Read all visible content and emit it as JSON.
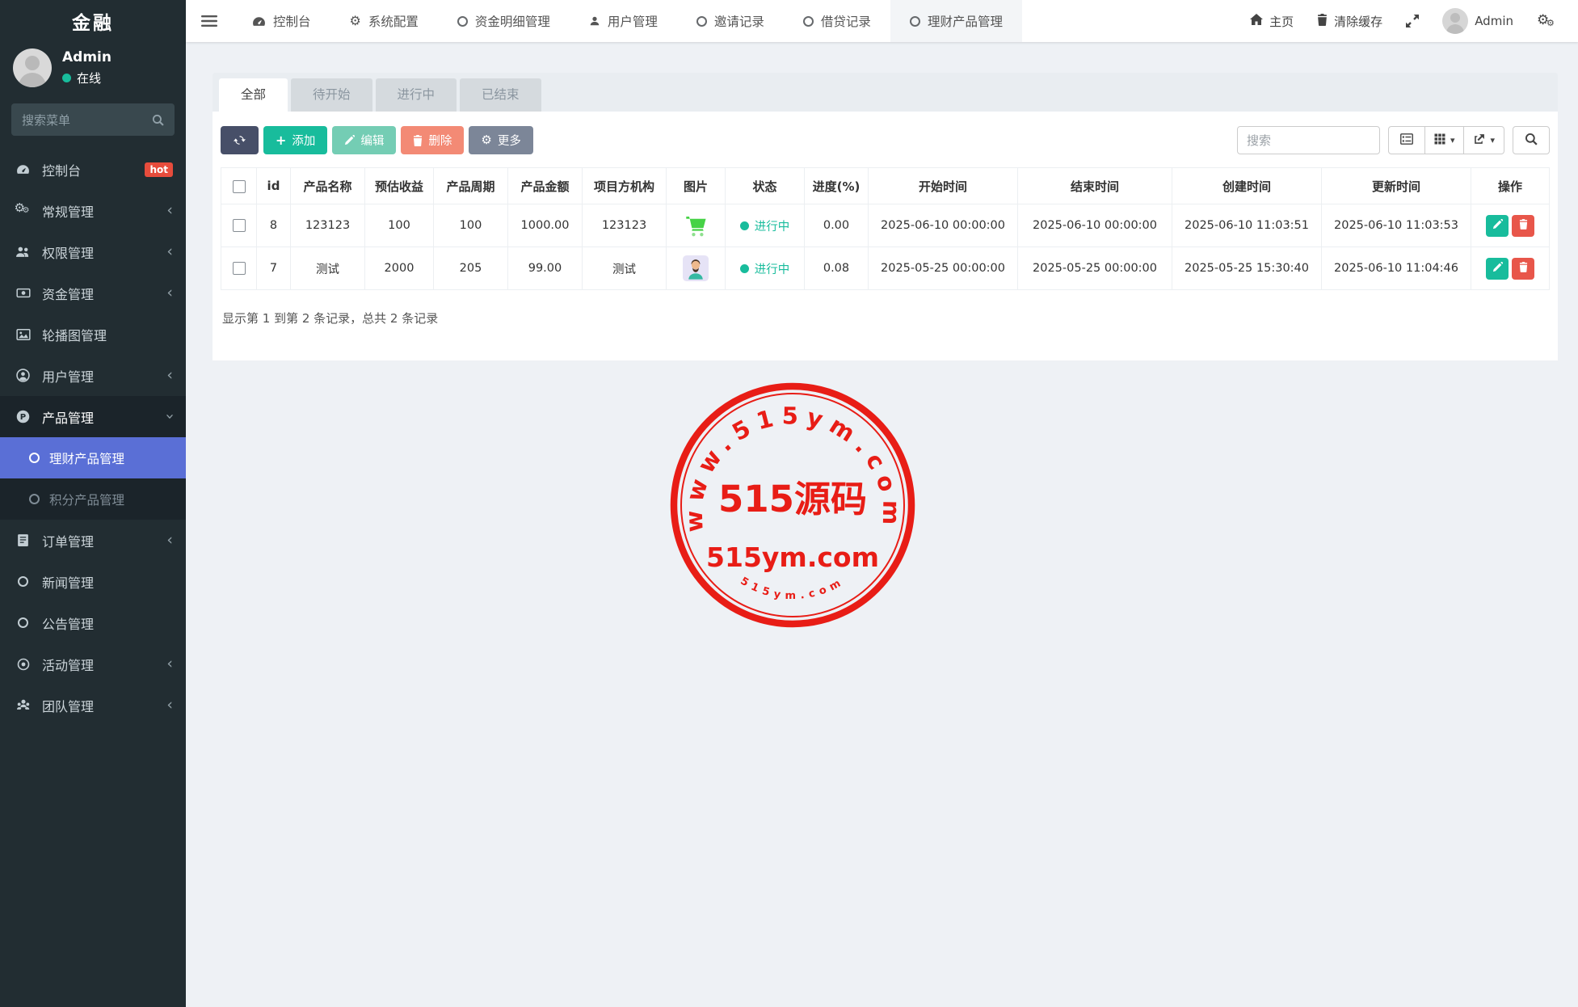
{
  "app": {
    "brand": "金融"
  },
  "sidebar": {
    "user": {
      "name": "Admin",
      "status_label": "在线"
    },
    "search_placeholder": "搜索菜单",
    "items": [
      {
        "key": "console",
        "label": "控制台",
        "icon": "dashboard-icon",
        "badge": "hot"
      },
      {
        "key": "general",
        "label": "常规管理",
        "icon": "gears-icon",
        "chevron": true
      },
      {
        "key": "permission",
        "label": "权限管理",
        "icon": "users-icon",
        "chevron": true
      },
      {
        "key": "funds",
        "label": "资金管理",
        "icon": "money-icon",
        "chevron": true
      },
      {
        "key": "banner",
        "label": "轮播图管理",
        "icon": "image-icon"
      },
      {
        "key": "users",
        "label": "用户管理",
        "icon": "user-circle-icon",
        "chevron": true
      },
      {
        "key": "products",
        "label": "产品管理",
        "icon": "p-circle-icon",
        "expanded": true,
        "children": [
          {
            "key": "wealth-products",
            "label": "理财产品管理",
            "active": true
          },
          {
            "key": "points-products",
            "label": "积分产品管理"
          }
        ]
      },
      {
        "key": "orders",
        "label": "订单管理",
        "icon": "orders-icon",
        "chevron": true
      },
      {
        "key": "news",
        "label": "新闻管理",
        "icon": "circle-icon"
      },
      {
        "key": "notice",
        "label": "公告管理",
        "icon": "circle-icon"
      },
      {
        "key": "activity",
        "label": "活动管理",
        "icon": "dot-circle-icon",
        "chevron": true
      },
      {
        "key": "team",
        "label": "团队管理",
        "icon": "team-icon",
        "chevron": true
      }
    ]
  },
  "topnav": {
    "tabs": [
      {
        "key": "console",
        "label": "控制台",
        "icon": "dashboard-icon"
      },
      {
        "key": "system-config",
        "label": "系统配置",
        "icon": "gear-icon"
      },
      {
        "key": "fund-details",
        "label": "资金明细管理",
        "icon": "circle-icon"
      },
      {
        "key": "user-mgmt",
        "label": "用户管理",
        "icon": "user-icon"
      },
      {
        "key": "invite-records",
        "label": "邀请记录",
        "icon": "circle-icon"
      },
      {
        "key": "loan-records",
        "label": "借贷记录",
        "icon": "circle-icon"
      },
      {
        "key": "wealth-products",
        "label": "理财产品管理",
        "icon": "circle-icon",
        "active": true
      }
    ],
    "home_label": "主页",
    "clear_cache_label": "清除缓存",
    "admin_label": "Admin"
  },
  "filter_tabs": [
    {
      "key": "all",
      "label": "全部",
      "active": true
    },
    {
      "key": "not-started",
      "label": "待开始"
    },
    {
      "key": "in-progress",
      "label": "进行中"
    },
    {
      "key": "finished",
      "label": "已结束"
    }
  ],
  "toolbar": {
    "add_label": "添加",
    "edit_label": "编辑",
    "delete_label": "删除",
    "more_label": "更多",
    "search_placeholder": "搜索"
  },
  "table": {
    "columns": [
      "id",
      "产品名称",
      "预估收益",
      "产品周期",
      "产品金额",
      "项目方机构",
      "图片",
      "状态",
      "进度(%)",
      "开始时间",
      "结束时间",
      "创建时间",
      "更新时间",
      "操作"
    ],
    "rows": [
      {
        "id": "8",
        "product_name": "123123",
        "expected_return": "100",
        "cycle": "100",
        "amount": "1000.00",
        "agency": "123123",
        "image": "cart-image",
        "status": "进行中",
        "progress": "0.00",
        "start_time": "2025-06-10 00:00:00",
        "end_time": "2025-06-10 00:00:00",
        "created_at": "2025-06-10 11:03:51",
        "updated_at": "2025-06-10 11:03:53"
      },
      {
        "id": "7",
        "product_name": "测试",
        "expected_return": "2000",
        "cycle": "205",
        "amount": "99.00",
        "agency": "测试",
        "image": "avatar-image",
        "status": "进行中",
        "progress": "0.08",
        "start_time": "2025-05-25 00:00:00",
        "end_time": "2025-05-25 00:00:00",
        "created_at": "2025-05-25 15:30:40",
        "updated_at": "2025-06-10 11:04:46"
      }
    ],
    "summary": "显示第 1 到第 2 条记录，总共 2 条记录"
  },
  "watermark": {
    "arc_top": "www.515ym.com",
    "center": "515源码",
    "line2": "515ym.com",
    "arc_bottom": "515ym.com",
    "color": "#e8150d"
  },
  "colors": {
    "teal": "#18bc9c",
    "active_menu_blue": "#5a6fd6",
    "sidebar_bg": "#222d32",
    "hot_badge_red": "#e74c3c",
    "delete_red": "#e8564a",
    "refresh_navy": "#474f68",
    "edit_light_green": "#74cdb4",
    "delete_salmon": "#f38a75",
    "more_gray": "#7c8698"
  }
}
